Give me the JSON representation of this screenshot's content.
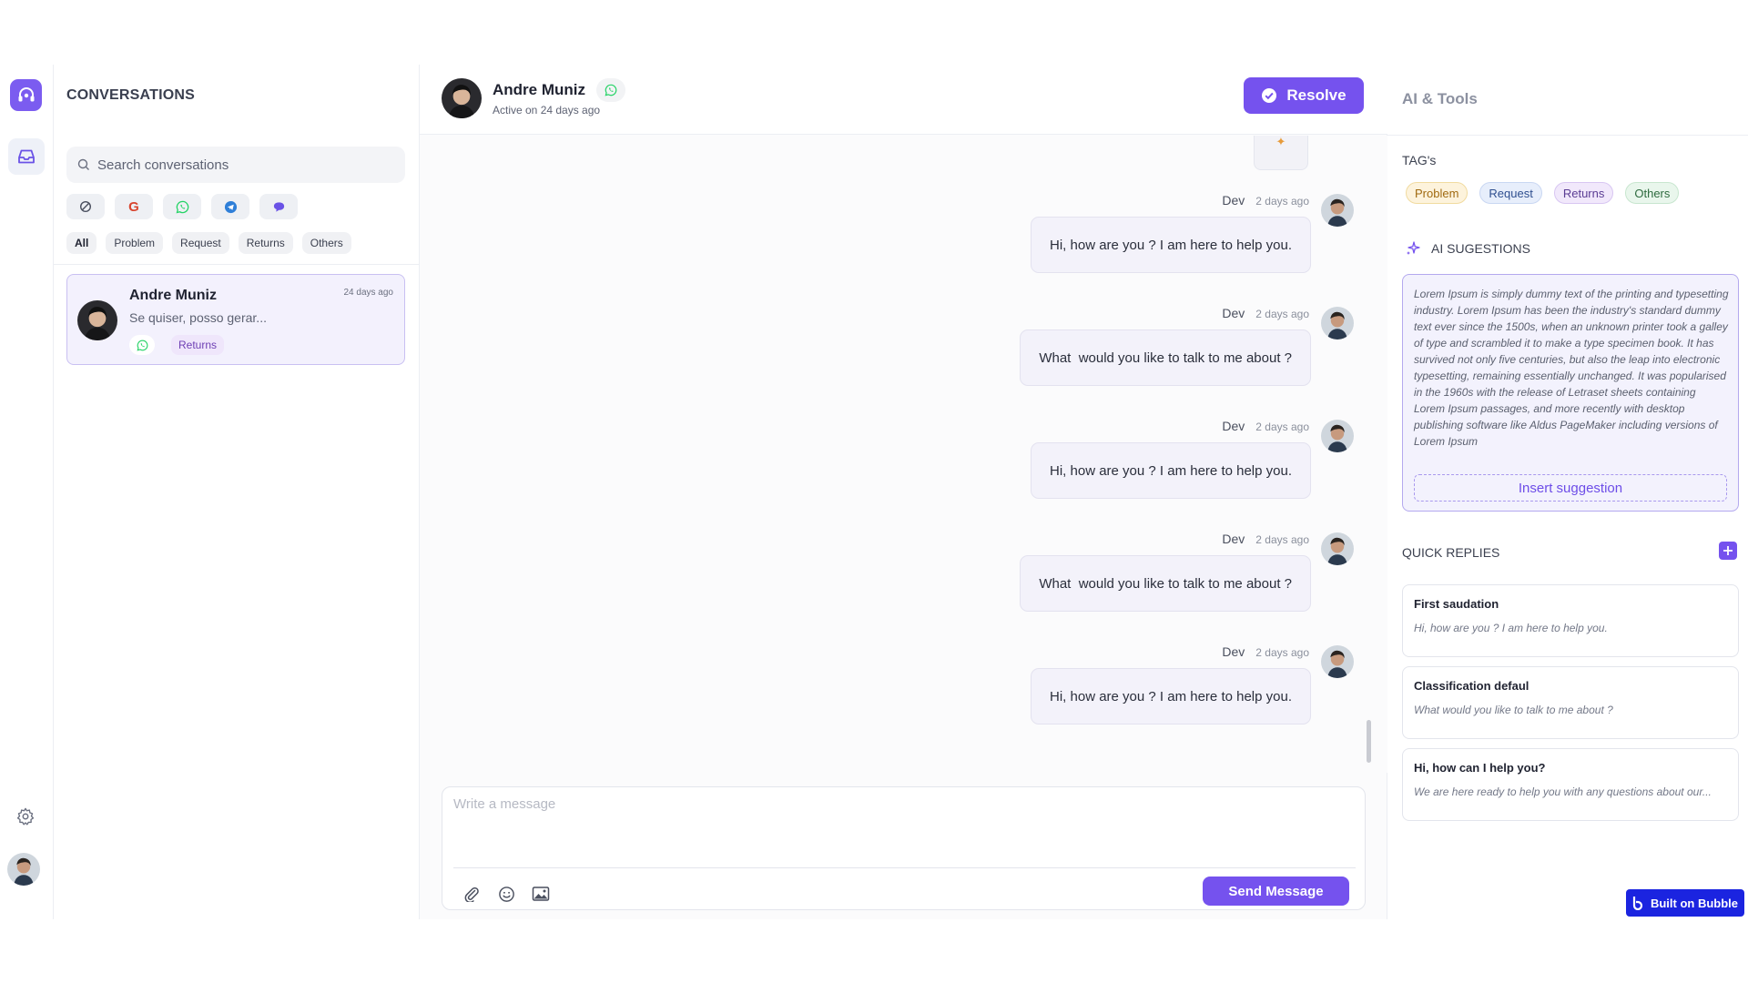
{
  "rail": {
    "logo": "app-logo",
    "inbox_icon": "inbox-icon",
    "settings_icon": "gear-icon"
  },
  "conversations": {
    "title": "CONVERSATIONS",
    "search_placeholder": "Search conversations",
    "channels": [
      "block-icon",
      "google-icon",
      "whatsapp-icon",
      "telegram-icon",
      "chat-bubble-icon"
    ],
    "filters": [
      "All",
      "Problem",
      "Request",
      "Returns",
      "Others"
    ],
    "active_filter": "All",
    "items": [
      {
        "name": "Andre Muniz",
        "time": "24 days ago",
        "preview": "Se quiser, posso gerar...",
        "channel": "whatsapp-icon",
        "tag": "Returns"
      }
    ]
  },
  "chat": {
    "contact_name": "Andre Muniz",
    "status": "Active on 24 days ago",
    "resolve_label": "Resolve",
    "messages": [
      {
        "sender": "Dev",
        "time": "2 days ago",
        "text": "Hi, how are you ? I am here to help you."
      },
      {
        "sender": "Dev",
        "time": "2 days ago",
        "text": "What  would you like to talk to me about ?"
      },
      {
        "sender": "Dev",
        "time": "2 days ago",
        "text": "Hi, how are you ? I am here to help you."
      },
      {
        "sender": "Dev",
        "time": "2 days ago",
        "text": "What  would you like to talk to me about ?"
      },
      {
        "sender": "Dev",
        "time": "2 days ago",
        "text": "Hi, how are you ? I am here to help you."
      }
    ],
    "composer_placeholder": "Write a message",
    "send_label": "Send Message"
  },
  "tools": {
    "title": "AI & Tools",
    "tags_title": "TAG's",
    "tags": [
      {
        "label": "Problem",
        "bg": "#fdf3dc",
        "fg": "#a06a10",
        "border": "#f1dba0"
      },
      {
        "label": "Request",
        "bg": "#e7eefb",
        "fg": "#2f4f8f",
        "border": "#c9d7f2"
      },
      {
        "label": "Returns",
        "bg": "#f1e8fb",
        "fg": "#5b3d94",
        "border": "#d8c6f2"
      },
      {
        "label": "Others",
        "bg": "#e9f6ec",
        "fg": "#2e6b3f",
        "border": "#c8e6cf"
      }
    ],
    "ai_title": "AI SUGESTIONS",
    "ai_text": "Lorem Ipsum is simply dummy text of the printing and typesetting industry. Lorem Ipsum has been the industry's standard dummy text ever since the 1500s, when an unknown printer took a galley of type and scrambled it to make a type specimen book. It has survived not only five centuries, but also the leap into electronic typesetting, remaining essentially unchanged. It was popularised in the 1960s with the release of Letraset sheets containing Lorem Ipsum passages, and more recently with desktop publishing software like Aldus PageMaker including versions of Lorem Ipsum",
    "insert_label": "Insert suggestion",
    "quick_title": "QUICK REPLIES",
    "quick_replies": [
      {
        "title": "First saudation",
        "body": "Hi, how are you ? I am here to help you."
      },
      {
        "title": "Classification defaul",
        "body": "What  would you like to talk to me about ?"
      },
      {
        "title": "Hi, how can I help you?",
        "body": "We are here ready to help you with any questions about our..."
      }
    ]
  },
  "badge": {
    "label": "Built on Bubble"
  },
  "colors": {
    "accent": "#7552ee",
    "whatsapp": "#25d366"
  }
}
